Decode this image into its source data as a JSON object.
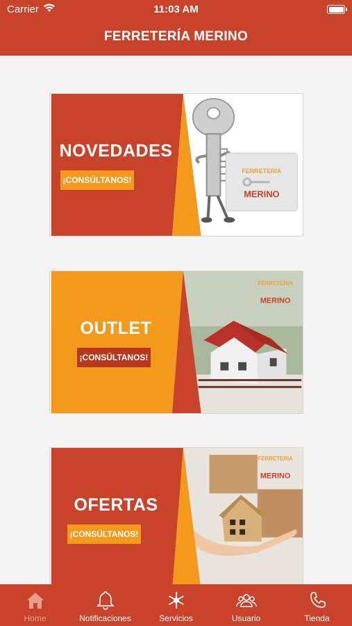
{
  "status": {
    "carrier": "Carrier",
    "time": "11:03 AM",
    "battery_level": 1.0
  },
  "header": {
    "title": "FERRETERÍA MERINO"
  },
  "banners": [
    {
      "title": "NOVEDADES",
      "cta": "¡CONSÚLTANOS!",
      "logo_top": "FERRETERIA",
      "logo_bottom": "MERINO"
    },
    {
      "title": "OUTLET",
      "cta": "¡CONSÚLTANOS!",
      "logo_top": "FERRETERIA",
      "logo_bottom": "MERINO"
    },
    {
      "title": "OFERTAS",
      "cta": "¡CONSÚLTANOS!",
      "logo_top": "FERRETERIA",
      "logo_bottom": "MERINO"
    }
  ],
  "tabs": [
    {
      "label": "Home",
      "icon": "home-icon",
      "active": true
    },
    {
      "label": "Notificaciones",
      "icon": "bell-icon",
      "active": false
    },
    {
      "label": "Servicios",
      "icon": "asterisk-icon",
      "active": false
    },
    {
      "label": "Usuario",
      "icon": "users-icon",
      "active": false
    },
    {
      "label": "Tienda",
      "icon": "phone-icon",
      "active": false
    }
  ],
  "colors": {
    "brand_red": "#c8432a",
    "brand_orange": "#f39a1d",
    "cta_dark": "#b8381f"
  }
}
